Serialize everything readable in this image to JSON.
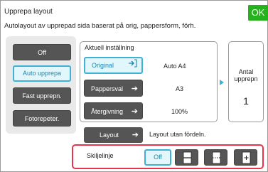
{
  "header": {
    "title": "Upprepa layout",
    "subtitle": "Autolayout av upprepad sida baserat på orig, pappersform, förh.",
    "ok_label": "OK"
  },
  "modes": [
    {
      "label": "Off",
      "selected": false
    },
    {
      "label": "Auto upprepa",
      "selected": true
    },
    {
      "label": "Fast upprepn.",
      "selected": false
    },
    {
      "label": "Fotorepeter.",
      "selected": false
    }
  ],
  "settings": {
    "heading": "Aktuell inställning",
    "rows": [
      {
        "label": "Original",
        "value": "Auto  A4",
        "selected": true
      },
      {
        "label": "Pappersval",
        "value": "A3",
        "selected": false
      },
      {
        "label": "Återgivning",
        "value": "100%",
        "selected": false
      }
    ]
  },
  "count": {
    "label_line1": "Antal",
    "label_line2": "upprepn",
    "value": "1"
  },
  "layout": {
    "button_label": "Layout",
    "info": "Layout utan fördeln."
  },
  "separator": {
    "label": "Skiljelinje",
    "off_label": "Off",
    "icons": [
      "separator-solid-line-icon",
      "separator-dashed-line-icon",
      "separator-crop-mark-icon"
    ]
  },
  "colors": {
    "ok_green": "#25b21c",
    "accent_blue": "#3fb1d7",
    "highlight_red": "#e8334c",
    "button_dark": "#555555"
  }
}
